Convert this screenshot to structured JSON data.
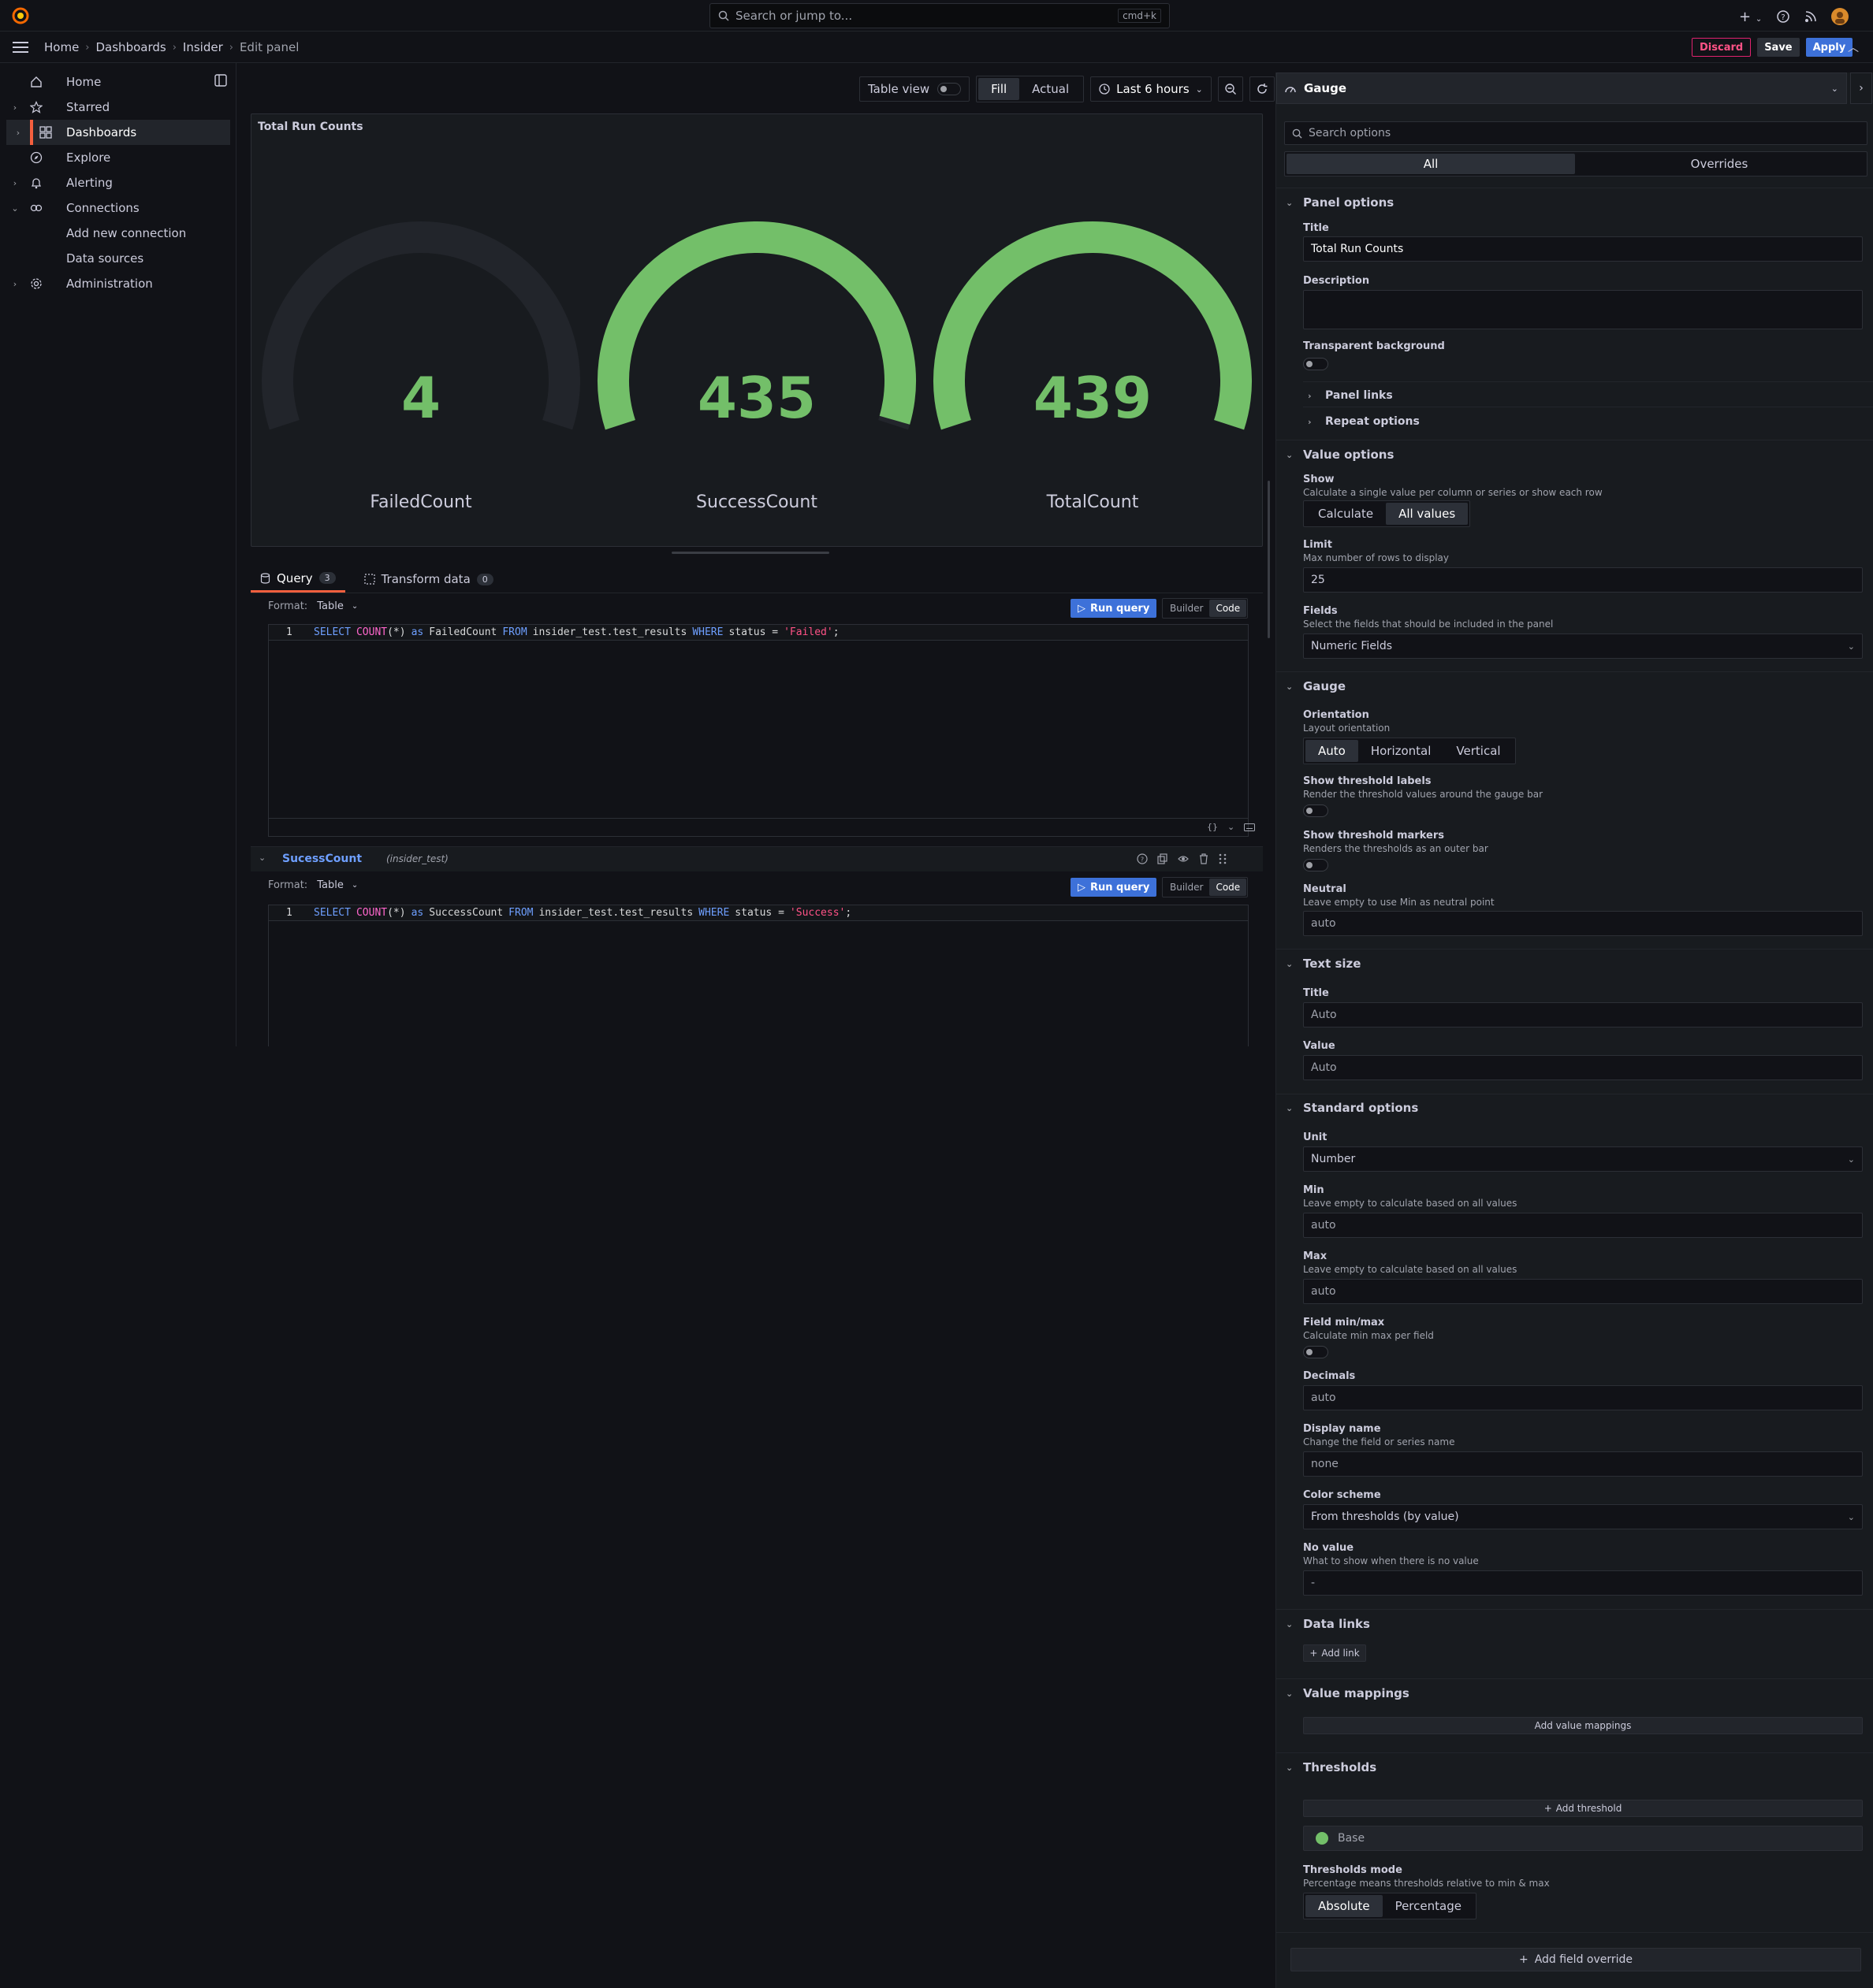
{
  "topbar": {
    "search_placeholder": "Search or jump to...",
    "search_shortcut": "cmd+k"
  },
  "breadcrumb": [
    "Home",
    "Dashboards",
    "Insider",
    "Edit panel"
  ],
  "actions": {
    "discard": "Discard",
    "save": "Save",
    "apply": "Apply"
  },
  "sidebar": {
    "items": [
      {
        "label": "Home",
        "icon": "home-icon"
      },
      {
        "label": "Starred",
        "icon": "star-icon"
      },
      {
        "label": "Dashboards",
        "icon": "apps-icon"
      },
      {
        "label": "Explore",
        "icon": "compass-icon"
      },
      {
        "label": "Alerting",
        "icon": "bell-icon"
      },
      {
        "label": "Connections",
        "icon": "connections-icon"
      },
      {
        "label": "Add new connection",
        "icon": ""
      },
      {
        "label": "Data sources",
        "icon": ""
      },
      {
        "label": "Administration",
        "icon": "cog-icon"
      }
    ]
  },
  "toolbar": {
    "table_view": "Table view",
    "fill": "Fill",
    "actual": "Actual",
    "time_range": "Last 6 hours"
  },
  "panel": {
    "title": "Total Run Counts",
    "gauges": [
      {
        "label": "FailedCount",
        "value": "4"
      },
      {
        "label": "SuccessCount",
        "value": "435"
      },
      {
        "label": "TotalCount",
        "value": "439"
      }
    ],
    "gauge_color": "#73bf69"
  },
  "query_tabs": {
    "query": "Query",
    "query_count": "3",
    "transform": "Transform data",
    "transform_count": "0"
  },
  "queries": [
    {
      "format_label": "Format:",
      "format_value": "Table",
      "run": "Run query",
      "builder": "Builder",
      "code": "Code",
      "line": "1",
      "sql": {
        "select": "SELECT",
        "fn": "COUNT",
        "arg": "(*)",
        "as": "as",
        "alias": "FailedCount",
        "from": "FROM",
        "table": "insider_test.test_results",
        "where": "WHERE",
        "cond": "status =",
        "value": "'Failed'",
        "end": ";"
      }
    },
    {
      "name": "SucessCount",
      "datasource": "(insider_test)",
      "format_label": "Format:",
      "format_value": "Table",
      "run": "Run query",
      "builder": "Builder",
      "code": "Code",
      "line": "1",
      "sql": {
        "select": "SELECT",
        "fn": "COUNT",
        "arg": "(*)",
        "as": "as",
        "alias": "SuccessCount",
        "from": "FROM",
        "table": "insider_test.test_results",
        "where": "WHERE",
        "cond": "status =",
        "value": "'Success'",
        "end": ";"
      }
    }
  ],
  "options": {
    "viz": "Gauge",
    "search_placeholder": "Search options",
    "tabs": {
      "all": "All",
      "overrides": "Overrides"
    },
    "panel_options": {
      "header": "Panel options",
      "title_label": "Title",
      "title_value": "Total Run Counts",
      "description_label": "Description",
      "transparent_label": "Transparent background",
      "panel_links": "Panel links",
      "repeat_options": "Repeat options"
    },
    "value_options": {
      "header": "Value options",
      "show_label": "Show",
      "show_desc": "Calculate a single value per column or series or show each row",
      "calculate": "Calculate",
      "all_values": "All values",
      "limit_label": "Limit",
      "limit_desc": "Max number of rows to display",
      "limit_value": "25",
      "fields_label": "Fields",
      "fields_desc": "Select the fields that should be included in the panel",
      "fields_value": "Numeric Fields"
    },
    "gauge": {
      "header": "Gauge",
      "orientation_label": "Orientation",
      "orientation_desc": "Layout orientation",
      "auto": "Auto",
      "horizontal": "Horizontal",
      "vertical": "Vertical",
      "threshold_labels_label": "Show threshold labels",
      "threshold_labels_desc": "Render the threshold values around the gauge bar",
      "threshold_markers_label": "Show threshold markers",
      "threshold_markers_desc": "Renders the thresholds as an outer bar",
      "neutral_label": "Neutral",
      "neutral_desc": "Leave empty to use Min as neutral point",
      "neutral_value": "auto"
    },
    "text_size": {
      "header": "Text size",
      "title_label": "Title",
      "title_placeholder": "Auto",
      "value_label": "Value",
      "value_placeholder": "Auto"
    },
    "standard": {
      "header": "Standard options",
      "unit_label": "Unit",
      "unit_value": "Number",
      "min_label": "Min",
      "min_desc": "Leave empty to calculate based on all values",
      "min_value": "auto",
      "max_label": "Max",
      "max_desc": "Leave empty to calculate based on all values",
      "max_value": "auto",
      "fieldminmax_label": "Field min/max",
      "fieldminmax_desc": "Calculate min max per field",
      "decimals_label": "Decimals",
      "decimals_value": "auto",
      "display_label": "Display name",
      "display_desc": "Change the field or series name",
      "display_value": "none",
      "color_label": "Color scheme",
      "color_value": "From thresholds (by value)",
      "novalue_label": "No value",
      "novalue_desc": "What to show when there is no value",
      "novalue_value": "-"
    },
    "data_links": {
      "header": "Data links",
      "add": "Add link"
    },
    "value_mappings": {
      "header": "Value mappings",
      "add": "Add value mappings"
    },
    "thresholds": {
      "header": "Thresholds",
      "add": "Add threshold",
      "base": "Base",
      "mode_label": "Thresholds mode",
      "mode_desc": "Percentage means thresholds relative to min & max",
      "absolute": "Absolute",
      "percentage": "Percentage"
    },
    "add_override": "Add field override"
  }
}
